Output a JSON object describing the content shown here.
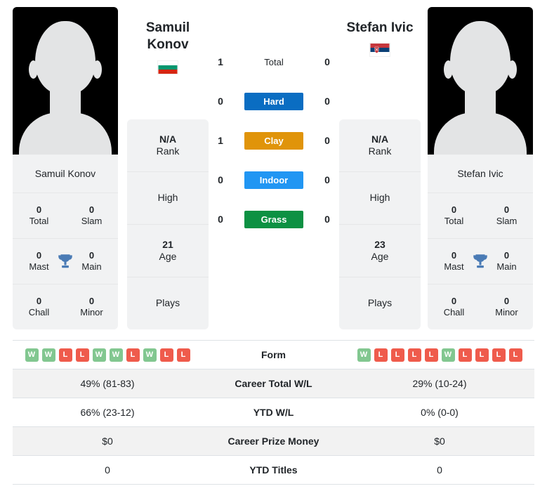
{
  "players": {
    "left": {
      "name": "Samuil Konov",
      "display_name_line1": "Samuil",
      "display_name_line2": "Konov",
      "country": "Bulgaria",
      "flag_icon": "bulgaria-flag-icon",
      "avatar_icon": "player-silhouette-icon",
      "titles": {
        "total": "0",
        "total_label": "Total",
        "slam": "0",
        "slam_label": "Slam",
        "mast": "0",
        "mast_label": "Mast",
        "main": "0",
        "main_label": "Main",
        "chall": "0",
        "chall_label": "Chall",
        "minor": "0",
        "minor_label": "Minor"
      },
      "info": {
        "rank_value": "N/A",
        "rank_label": "Rank",
        "high_value": "",
        "high_label": "High",
        "age_value": "21",
        "age_label": "Age",
        "plays_value": "",
        "plays_label": "Plays"
      },
      "form": [
        "W",
        "W",
        "L",
        "L",
        "W",
        "W",
        "L",
        "W",
        "L",
        "L"
      ],
      "career_total_wl": "49% (81-83)",
      "ytd_wl": "66% (23-12)",
      "career_prize_money": "$0",
      "ytd_titles": "0"
    },
    "right": {
      "name": "Stefan Ivic",
      "display_name_line1": "Stefan Ivic",
      "display_name_line2": "",
      "country": "Serbia",
      "flag_icon": "serbia-flag-icon",
      "avatar_icon": "player-silhouette-icon",
      "titles": {
        "total": "0",
        "total_label": "Total",
        "slam": "0",
        "slam_label": "Slam",
        "mast": "0",
        "mast_label": "Mast",
        "main": "0",
        "main_label": "Main",
        "chall": "0",
        "chall_label": "Chall",
        "minor": "0",
        "minor_label": "Minor"
      },
      "info": {
        "rank_value": "N/A",
        "rank_label": "Rank",
        "high_value": "",
        "high_label": "High",
        "age_value": "23",
        "age_label": "Age",
        "plays_value": "",
        "plays_label": "Plays"
      },
      "form": [
        "W",
        "L",
        "L",
        "L",
        "L",
        "W",
        "L",
        "L",
        "L",
        "L"
      ],
      "career_total_wl": "29% (10-24)",
      "ytd_wl": "0% (0-0)",
      "career_prize_money": "$0",
      "ytd_titles": "0"
    }
  },
  "head_to_head": {
    "rows": [
      {
        "label": "Total",
        "left": "1",
        "right": "0",
        "style": "plain",
        "color": ""
      },
      {
        "label": "Hard",
        "left": "0",
        "right": "0",
        "style": "pill",
        "color": "#0a6dc2"
      },
      {
        "label": "Clay",
        "left": "1",
        "right": "0",
        "style": "pill",
        "color": "#e0940a"
      },
      {
        "label": "Indoor",
        "left": "0",
        "right": "0",
        "style": "pill",
        "color": "#2196f3"
      },
      {
        "label": "Grass",
        "left": "0",
        "right": "0",
        "style": "pill",
        "color": "#0d9143"
      }
    ]
  },
  "stats_table": {
    "rows": [
      {
        "label": "Form",
        "type": "form",
        "left": "",
        "right": ""
      },
      {
        "label": "Career Total W/L",
        "type": "text",
        "left": "49% (81-83)",
        "right": "29% (10-24)"
      },
      {
        "label": "YTD W/L",
        "type": "text",
        "left": "66% (23-12)",
        "right": "0% (0-0)"
      },
      {
        "label": "Career Prize Money",
        "type": "text",
        "left": "$0",
        "right": "$0"
      },
      {
        "label": "YTD Titles",
        "type": "text",
        "left": "0",
        "right": "0"
      }
    ]
  },
  "colors": {
    "win_badge": "#82c790",
    "loss_badge": "#ef5b4c",
    "card_bg": "#f1f2f3",
    "row_alt_bg": "#f2f2f2",
    "trophy": "#4a7bb5"
  }
}
